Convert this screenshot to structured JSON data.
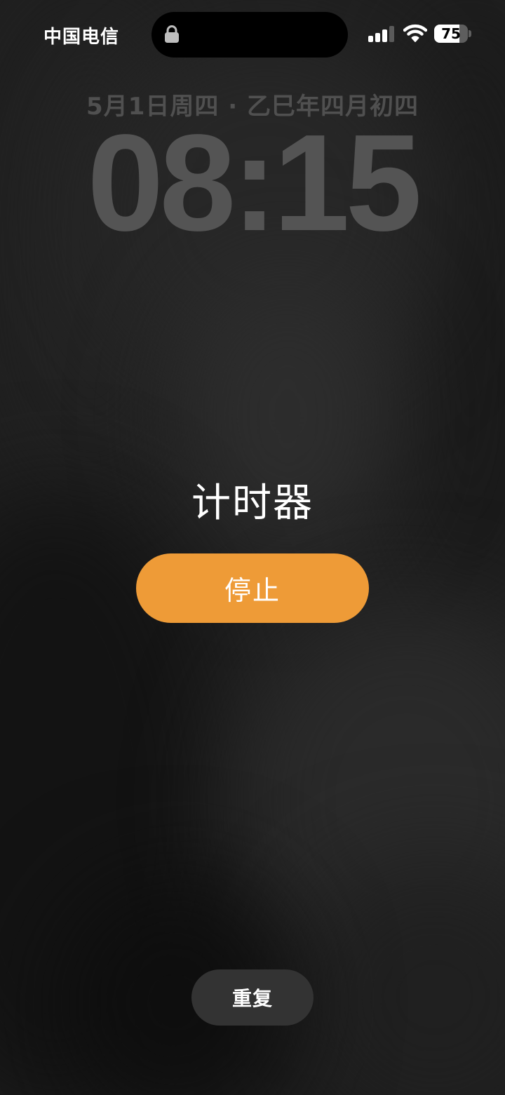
{
  "status_bar": {
    "carrier": "中国电信",
    "lock_icon": "lock-icon",
    "signal_icon": "cellular-signal-icon",
    "signal_bars_active": 3,
    "signal_bars_total": 4,
    "wifi_icon": "wifi-icon",
    "battery_icon": "battery-icon",
    "battery_percent": "75",
    "battery_level": 0.75
  },
  "lock_screen": {
    "date": "5月1日周四 · 乙巳年四月初四",
    "time": "08:15"
  },
  "alert": {
    "title": "计时器",
    "stop_label": "停止",
    "repeat_label": "重复"
  },
  "colors": {
    "accent": "#ee9b37",
    "secondary_button": "#333333",
    "date_text": "#505050",
    "clock_text": "#545454"
  }
}
